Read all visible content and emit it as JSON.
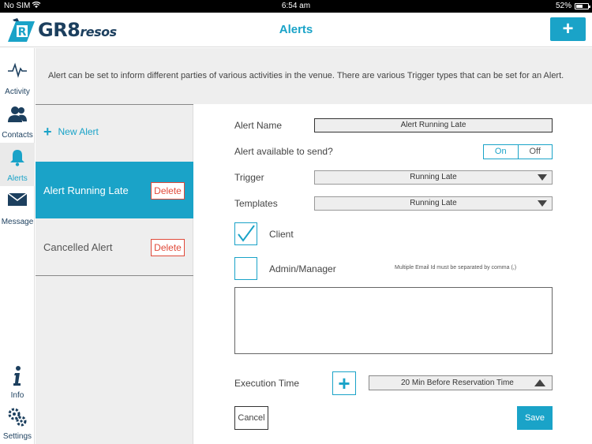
{
  "status_bar": {
    "carrier": "No SIM",
    "time": "6:54 am",
    "battery": "52%"
  },
  "header": {
    "logo_main": "GR8",
    "logo_sub": "resos",
    "title": "Alerts",
    "add_label": "+"
  },
  "nav": {
    "items": [
      {
        "label": "Activity",
        "icon": "activity-icon"
      },
      {
        "label": "Contacts",
        "icon": "contacts-icon"
      },
      {
        "label": "Alerts",
        "icon": "bell-icon"
      },
      {
        "label": "Message",
        "icon": "envelope-icon"
      },
      {
        "label": "Info",
        "icon": "info-icon"
      },
      {
        "label": "Settings",
        "icon": "gears-icon"
      }
    ]
  },
  "banner": {
    "text": "Alert can be set to inform different parties of various activities in the venue. There are various Trigger types that can be set for an Alert."
  },
  "list": {
    "new_alert_label": "New Alert",
    "alerts": [
      {
        "name": "Alert Running Late",
        "delete_label": "Delete"
      },
      {
        "name": "Cancelled Alert",
        "delete_label": "Delete"
      }
    ]
  },
  "form": {
    "alert_name_label": "Alert Name",
    "alert_name_value": "Alert Running Late",
    "available_label": "Alert available to send?",
    "on_label": "On",
    "off_label": "Off",
    "trigger_label": "Trigger",
    "trigger_value": "Running Late",
    "templates_label": "Templates",
    "templates_value": "Running Late",
    "client_label": "Client",
    "admin_label": "Admin/Manager",
    "email_hint": "Multiple Email Id must be separated by comma (,)",
    "execution_label": "Execution Time",
    "execution_value": "20 Min Before Reservation Time",
    "cancel_label": "Cancel",
    "save_label": "Save"
  },
  "colors": {
    "accent": "#1aa3c8",
    "brand_dark": "#1c3f5e",
    "delete": "#e04a3a"
  }
}
